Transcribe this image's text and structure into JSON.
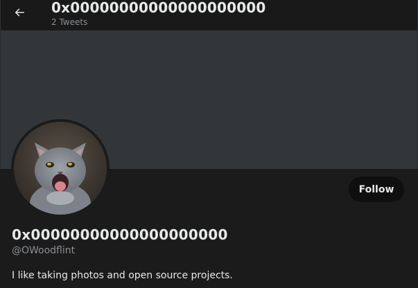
{
  "header": {
    "title": "0x00000000000000000000",
    "tweet_count": "2 Tweets",
    "back_icon": "arrow-left-icon"
  },
  "profile": {
    "display_name": "0x00000000000000000000",
    "handle": "@OWoodflint",
    "bio": "I like taking photos and open source projects.",
    "follow_label": "Follow",
    "avatar_subject": "gray kitten with open mouth"
  },
  "colors": {
    "background": "#1b1b1b",
    "banner": "#333639",
    "text_primary": "#e7e9ea",
    "text_secondary": "#8b8f94",
    "follow_button_bg": "#0f0f0f"
  }
}
